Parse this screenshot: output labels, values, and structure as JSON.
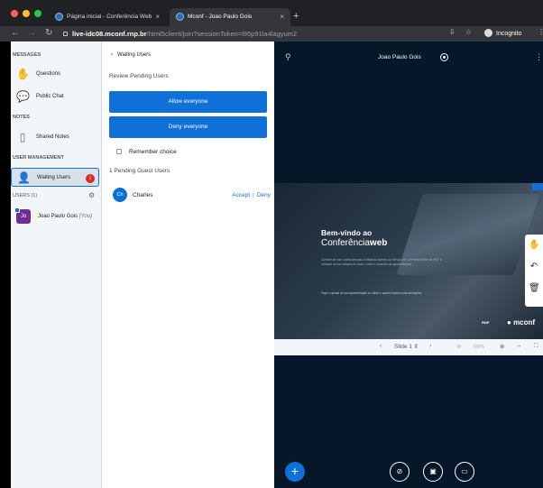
{
  "browser": {
    "tabs": [
      {
        "title": "Página inicial - Conferência Web"
      },
      {
        "title": "Mconf - Joao Paulo Gois"
      }
    ],
    "url_host": "live-idc08.mconf.rnp.br",
    "url_path": "/html5client/join?sessionToken=l95p91la4lagyum2",
    "incognito_label": "Incognito"
  },
  "sidebar": {
    "messages_title": "MESSAGES",
    "questions": "Questions",
    "public_chat": "Public Chat",
    "notes_title": "NOTES",
    "shared_notes": "Shared Notes",
    "user_mgmt_title": "USER MANAGEMENT",
    "waiting_users": "Waiting Users",
    "waiting_badge": "1",
    "users_title": "USERS (1)",
    "user_initials": "Jo",
    "user_name": "Joao Paulo Gois",
    "user_you": "(You)"
  },
  "panel": {
    "back_label": "Waiting Users",
    "review_label": "Review Pending Users",
    "allow_label": "Allow everyone",
    "deny_label": "Deny everyone",
    "remember_label": "Remember choice",
    "pending_label": "1 Pending Guest Users",
    "guest": {
      "initials": "Ch",
      "name": "Charles",
      "accept": "Accept",
      "deny": "Deny"
    }
  },
  "stage": {
    "presenter_name": "Joao Paulo Gois",
    "slide_title1": "Bem-vindo ao",
    "slide_title2a": "Conferência",
    "slide_title2b": "web",
    "slide_body": "Conecte-se com outras pessoas à distância através do Serviço de Conferência Web da RNP e colabore ao vivo através de áudio, vídeo e conteúdo de apresentações.",
    "slide_body2": "Faça o upload de sua apresentação ou utilize o quadro branco para anotações.",
    "slide_logo1": "RNP",
    "slide_logo2": "mconf",
    "slide_select": "Slide 1",
    "zoom": "100%"
  },
  "colors": {
    "accent": "#0f70d7",
    "stage_bg": "#06172a",
    "badge": "#de2721"
  }
}
